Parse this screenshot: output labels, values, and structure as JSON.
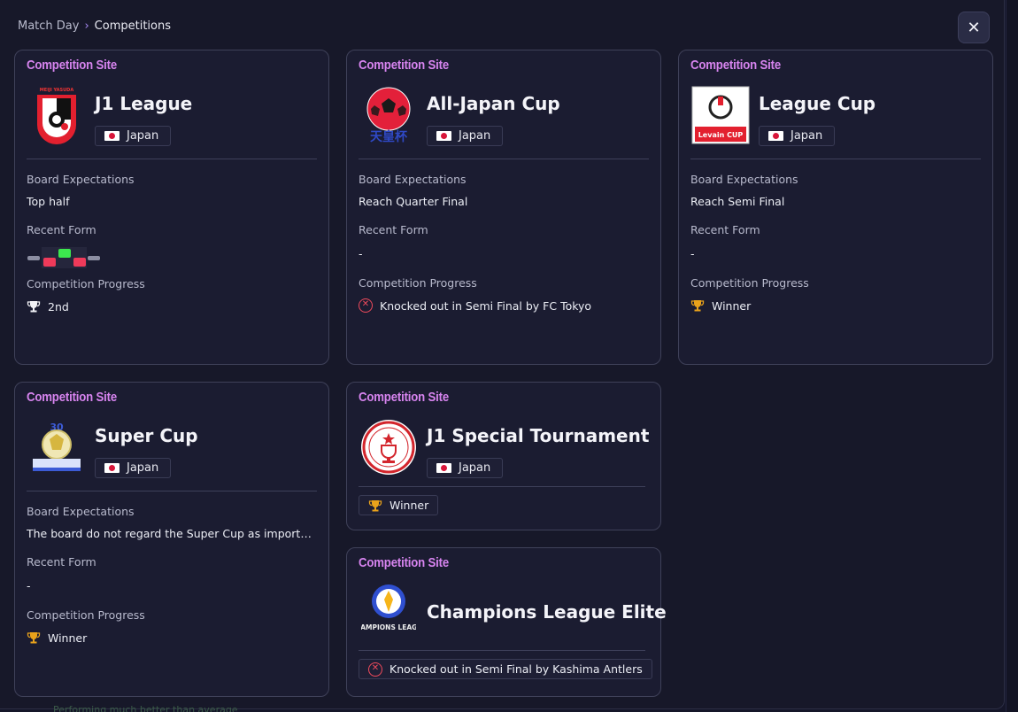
{
  "breadcrumb": {
    "parent": "Match Day",
    "separator": "›",
    "current": "Competitions"
  },
  "close_label": "✕",
  "tag_label": "Competition Site",
  "labels": {
    "board": "Board Expectations",
    "form": "Recent Form",
    "progress": "Competition Progress"
  },
  "colors": {
    "accent_tag": "#d784ef",
    "win": "#3ce84e",
    "loss": "#ef3a5a",
    "draw": "#8c8ea2",
    "trophy_gold": "#e9a21b",
    "knocked_out": "#ef4a5c"
  },
  "cards": [
    {
      "name": "J1 League",
      "nation": "Japan",
      "board": "Top half",
      "form": [
        "draw",
        "loss",
        "win",
        "loss",
        "draw"
      ],
      "progress": "2nd",
      "progress_icon": "trophy-silver-icon"
    },
    {
      "name": "All-Japan Cup",
      "nation": "Japan",
      "board": "Reach Quarter Final",
      "form_text": "-",
      "progress": "Knocked out in Semi Final by FC Tokyo",
      "progress_icon": "knocked-out-icon"
    },
    {
      "name": "League Cup",
      "nation": "Japan",
      "board": "Reach Semi Final",
      "form_text": "-",
      "progress": "Winner",
      "progress_icon": "trophy-gold-icon"
    },
    {
      "name": "Super Cup",
      "nation": "Japan",
      "board": "The board do not regard the Super Cup as important and...",
      "form_text": "-",
      "progress": "Winner",
      "progress_icon": "trophy-gold-icon"
    },
    {
      "name": "J1 Special Tournament",
      "nation": "Japan",
      "progress": "Winner",
      "progress_icon": "trophy-gold-icon"
    },
    {
      "name": "Champions League Elite",
      "progress": "Knocked out in Semi Final by Kashima Antlers",
      "progress_icon": "knocked-out-icon"
    }
  ],
  "logo_text": {
    "all_japan": "天皇杯",
    "league_cup": "Levain CUP",
    "super_cup_num": "30",
    "acl": "CHAMPIONS LEAGUE"
  },
  "ghost_text": "Performing much better than average"
}
